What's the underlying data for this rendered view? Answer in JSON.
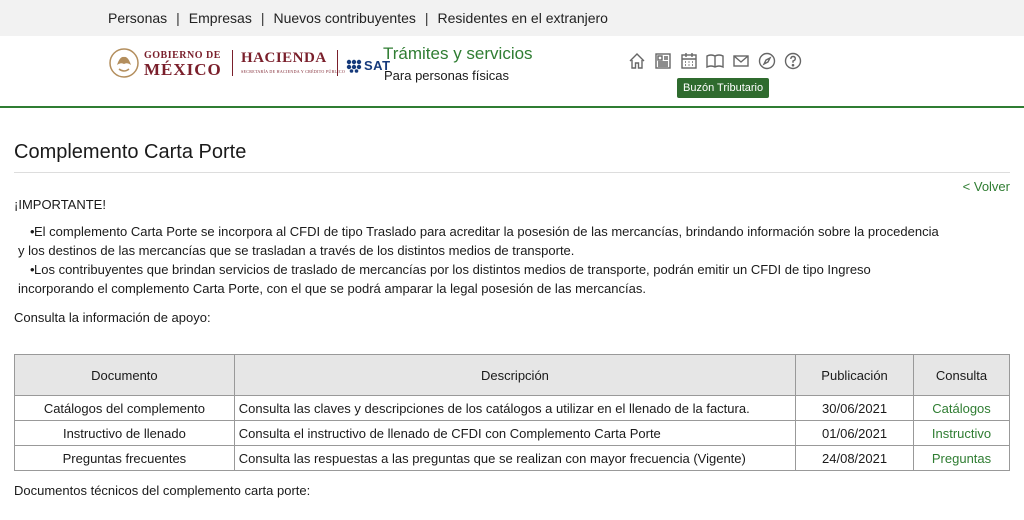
{
  "topnav": {
    "items": [
      "Personas",
      "Empresas",
      "Nuevos contribuyentes",
      "Residentes en el extranjero"
    ],
    "separator": "|"
  },
  "header": {
    "gobierno_line1": "GOBIERNO DE",
    "gobierno_line2": "MÉXICO",
    "hacienda": "HACIENDA",
    "hacienda_sub": "SECRETARÍA DE HACIENDA Y CRÉDITO PÚBLICO",
    "sat": "SAT",
    "site_title": "Trámites y servicios",
    "site_subtitle": "Para personas físicas",
    "buzon": "Buzón Tributario",
    "icons": [
      "home-icon",
      "newspaper-icon",
      "calendar-icon",
      "book-icon",
      "mail-icon",
      "compass-icon",
      "help-icon"
    ],
    "accent_color": "#2f7d32"
  },
  "page": {
    "title": "Complemento Carta Porte",
    "back": "< Volver",
    "important": "¡IMPORTANTE!",
    "bullets": [
      {
        "line1": "El complemento Carta Porte se incorpora al CFDI de tipo Traslado para acreditar la posesión de las mercancías, brindando información sobre la procedencia",
        "line2": "y los destinos de las mercancías que se trasladan a través de los distintos medios de transporte."
      },
      {
        "line1": "Los contribuyentes que brindan servicios de traslado de mercancías por los distintos medios de transporte, podrán emitir un CFDI de tipo Ingreso",
        "line2": "incorporando el complemento Carta Porte, con el que se podrá amparar la legal posesión de las mercancías."
      }
    ],
    "consulta": "Consulta la información de apoyo:",
    "tech": "Documentos técnicos del complemento carta porte:"
  },
  "table": {
    "headers": [
      "Documento",
      "Descripción",
      "Publicación",
      "Consulta"
    ],
    "rows": [
      [
        "Catálogos del complemento",
        "Consulta las claves y descripciones de los catálogos a utilizar en el llenado de la factura.",
        "30/06/2021",
        "Catálogos"
      ],
      [
        "Instructivo de llenado",
        "Consulta el instructivo de llenado de CFDI con Complemento Carta Porte",
        "01/06/2021",
        "Instructivo"
      ],
      [
        "Preguntas frecuentes",
        "Consulta las respuestas a las preguntas que se realizan con mayor frecuencia (Vigente)",
        "24/08/2021",
        "Preguntas"
      ]
    ]
  }
}
